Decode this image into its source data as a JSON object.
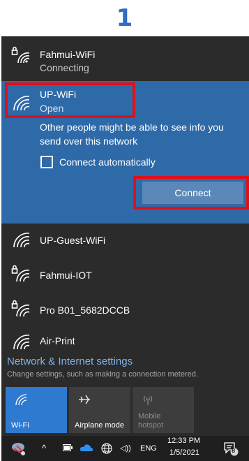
{
  "step_number": "1",
  "networks": {
    "fahmui_wifi": {
      "name": "Fahmui-WiFi",
      "status": "Connecting"
    },
    "up_wifi": {
      "name": "UP-WiFi",
      "status": "Open",
      "warning": "Other people might be able to see info you send over this network",
      "auto_connect_label": "Connect automatically",
      "auto_connect_checked": false,
      "connect_button": "Connect"
    },
    "up_guest_wifi": {
      "name": "UP-Guest-WiFi"
    },
    "fahmui_iot": {
      "name": "Fahmui-IOT"
    },
    "pro_b01": {
      "name": "Pro B01_5682DCCB"
    },
    "air_print": {
      "name": "Air-Print"
    }
  },
  "settings": {
    "title": "Network & Internet settings",
    "subtitle": "Change settings, such as making a connection metered."
  },
  "quick_actions": {
    "wifi": "Wi-Fi",
    "airplane": "Airplane mode",
    "hotspot": "Mobile hotspot"
  },
  "taskbar": {
    "language": "ENG",
    "time": "12:33 PM",
    "date": "1/5/2021",
    "notification_count": "8"
  },
  "colors": {
    "panel_bg": "#2b2b2b",
    "selected_bg": "#2f6aa8",
    "highlight_border": "#e0101a",
    "accent_link": "#7fb3e8",
    "step_number": "#2f6ec7"
  }
}
